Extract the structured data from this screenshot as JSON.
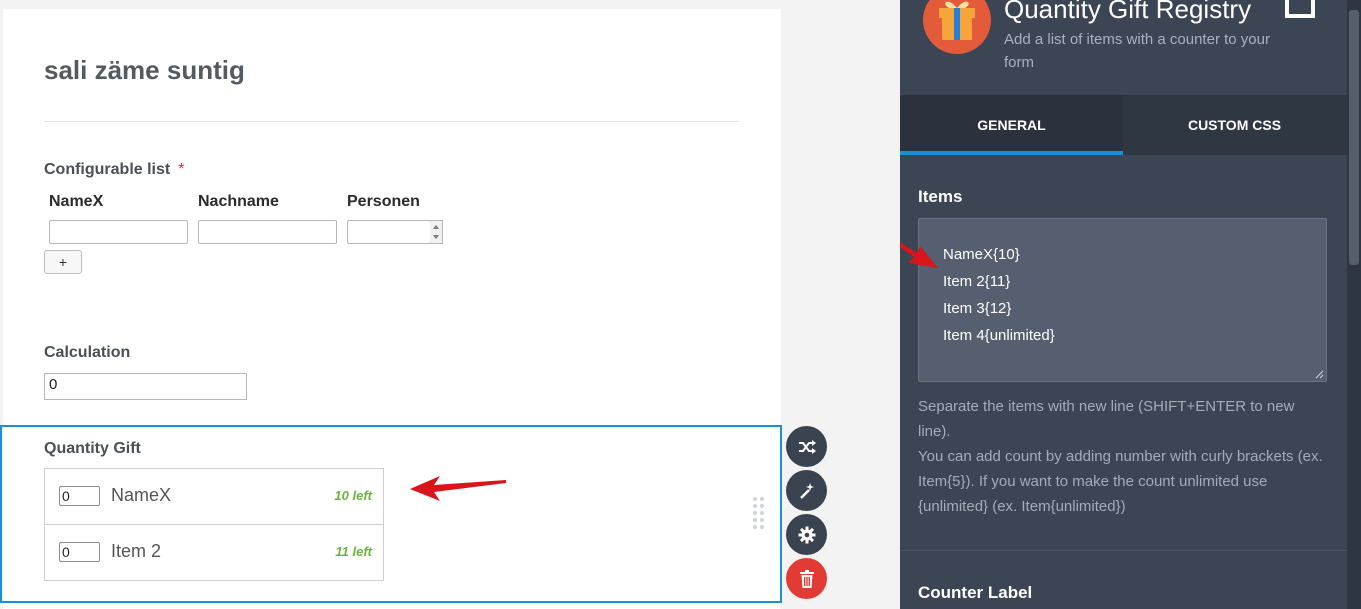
{
  "form": {
    "title": "sali zäme suntig",
    "configurable_list": {
      "label": "Configurable list",
      "required_mark": "*",
      "columns": [
        "NameX",
        "Nachname",
        "Personen"
      ],
      "add_button": "+"
    },
    "calculation": {
      "label": "Calculation",
      "value": "0"
    },
    "quantity_gift": {
      "label": "Quantity Gift",
      "rows": [
        {
          "count": "0",
          "name": "NameX",
          "left": "10 left"
        },
        {
          "count": "0",
          "name": "Item 2",
          "left": "11 left"
        }
      ]
    }
  },
  "toolbar_icons": [
    "shuffle-icon",
    "magic-wand-icon",
    "gear-icon",
    "trash-icon"
  ],
  "panel": {
    "title": "Quantity Gift Registry",
    "subtitle": "Add a list of items with a counter to your form",
    "tabs": [
      "GENERAL",
      "CUSTOM CSS"
    ],
    "active_tab": "GENERAL",
    "items_heading": "Items",
    "items": [
      "NameX{10}",
      "Item 2{11}",
      "Item 3{12}",
      "Item 4{unlimited}"
    ],
    "help_line1": "Separate the items with new line (SHIFT+ENTER to new line).",
    "help_line2": "You can add count by adding number with curly brackets (ex. Item{5}). If you want to make the count unlimited use {unlimited} (ex. Item{unlimited})",
    "counter_label_heading": "Counter Label"
  },
  "colors": {
    "accent": "#1d8fd6",
    "panel_bg": "#3b4554",
    "delete": "#e23b36",
    "count_left": "#6cb33f",
    "arrow": "#d9141b"
  }
}
